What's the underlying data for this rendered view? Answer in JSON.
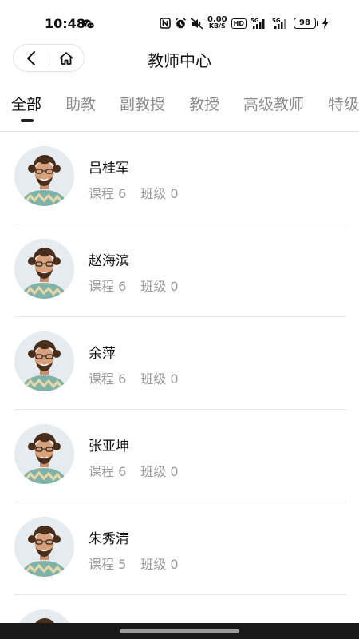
{
  "status_bar": {
    "time": "10:48",
    "net_speed_value": "0.00",
    "net_speed_unit": "KB/S",
    "network_1": "5G",
    "network_2": "5G",
    "hd_label": "HD",
    "battery": "98"
  },
  "header": {
    "title": "教师中心"
  },
  "tabs": [
    {
      "label": "全部",
      "active": true
    },
    {
      "label": "助教",
      "active": false
    },
    {
      "label": "副教授",
      "active": false
    },
    {
      "label": "教授",
      "active": false
    },
    {
      "label": "高级教师",
      "active": false
    },
    {
      "label": "特级",
      "active": false
    }
  ],
  "teachers": [
    {
      "name": "吕桂军",
      "courses": "课程 6",
      "classes": "班级 0"
    },
    {
      "name": "赵海滨",
      "courses": "课程 6",
      "classes": "班级 0"
    },
    {
      "name": "余萍",
      "courses": "课程 6",
      "classes": "班级 0"
    },
    {
      "name": "张亚坤",
      "courses": "课程 6",
      "classes": "班级 0"
    },
    {
      "name": "朱秀清",
      "courses": "课程 5",
      "classes": "班级 0"
    }
  ],
  "colors": {
    "text_primary": "#111111",
    "text_secondary": "#9a9a9a",
    "tab_inactive": "#8c8c8c",
    "divider": "#e8e8e8"
  }
}
